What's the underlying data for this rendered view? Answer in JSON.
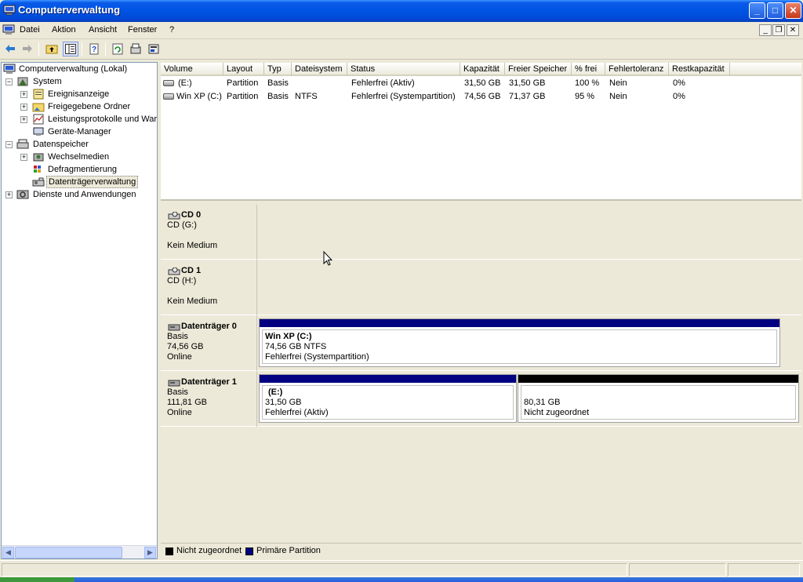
{
  "window": {
    "title": "Computerverwaltung",
    "buttons": {
      "minimize": "_",
      "maximize": "□",
      "close": "✕"
    }
  },
  "menu": {
    "items": [
      "Datei",
      "Aktion",
      "Ansicht",
      "Fenster",
      "?"
    ],
    "mdi_buttons": {
      "minimize": "_",
      "restore": "❐",
      "close": "✕"
    }
  },
  "toolbar": {
    "icons": [
      "back-icon",
      "forward-icon",
      "up-folder-icon",
      "show-hide-tree-icon",
      "properties-icon",
      "refresh-icon",
      "disk-properties-icon",
      "settings-icon"
    ]
  },
  "tree": {
    "root": "Computerverwaltung (Lokal)",
    "system": "System",
    "items_system": [
      "Ereignisanzeige",
      "Freigegebene Ordner",
      "Leistungsprotokolle und Warr",
      "Geräte-Manager"
    ],
    "storage": "Datenspeicher",
    "items_storage": [
      "Wechselmedien",
      "Defragmentierung",
      "Datenträgerverwaltung"
    ],
    "services": "Dienste und Anwendungen"
  },
  "volume_list": {
    "columns": [
      "Volume",
      "Layout",
      "Typ",
      "Dateisystem",
      "Status",
      "Kapazität",
      "Freier Speicher",
      "% frei",
      "Fehlertoleranz",
      "Restkapazität"
    ],
    "rows": [
      [
        "(E:)",
        "Partition",
        "Basis",
        "",
        "Fehlerfrei (Aktiv)",
        "31,50 GB",
        "31,50 GB",
        "100 %",
        "Nein",
        "0%"
      ],
      [
        "Win XP (C:)",
        "Partition",
        "Basis",
        "NTFS",
        "Fehlerfrei (Systempartition)",
        "74,56 GB",
        "71,37 GB",
        "95 %",
        "Nein",
        "0%"
      ]
    ]
  },
  "disks": [
    {
      "name": "CD 0",
      "line1": "CD (G:)",
      "line2": "",
      "line3": "Kein Medium"
    },
    {
      "name": "CD 1",
      "line1": "CD (H:)",
      "line2": "",
      "line3": "Kein Medium"
    },
    {
      "name": "Datenträger 0",
      "line1": "Basis",
      "line2": "74,56 GB",
      "line3": "Online"
    },
    {
      "name": "Datenträger 1",
      "line1": "Basis",
      "line2": "111,81 GB",
      "line3": "Online"
    }
  ],
  "partitions": {
    "disk0_p1": {
      "title": "Win XP  (C:)",
      "size": "74,56 GB NTFS",
      "status": "Fehlerfrei (Systempartition)"
    },
    "disk1_p1": {
      "title": "(E:)",
      "size": "31,50 GB",
      "status": "Fehlerfrei (Aktiv)"
    },
    "disk1_p2": {
      "title": "",
      "size": "80,31 GB",
      "status": "Nicht zugeordnet"
    }
  },
  "legend": {
    "unallocated": "Nicht zugeordnet",
    "primary": "Primäre Partition"
  },
  "colors": {
    "primary_partition": "#000080",
    "unallocated": "#000000",
    "titlebar": "#0054e3"
  }
}
